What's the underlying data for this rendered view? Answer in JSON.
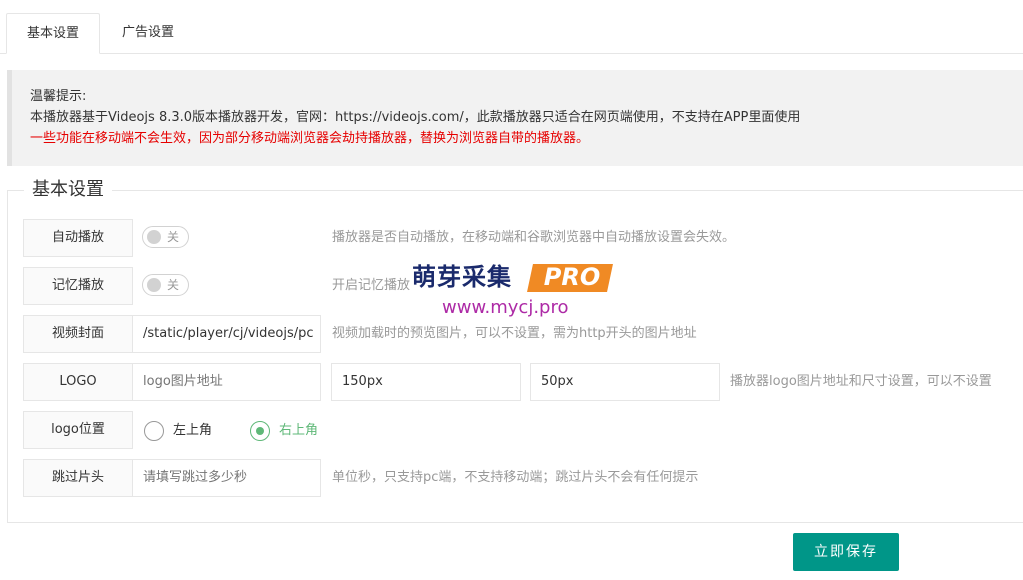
{
  "tabs": [
    {
      "label": "基本设置",
      "active": true
    },
    {
      "label": "广告设置",
      "active": false
    }
  ],
  "notice": {
    "title": "温馨提示:",
    "line1": "本播放器基于Videojs 8.3.0版本播放器开发，官网：https://videojs.com/，此款播放器只适合在网页端使用，不支持在APP里面使用",
    "line2_red": "一些功能在移动端不会生效，因为部分移动端浏览器会劫持播放器，替换为浏览器自带的播放器。"
  },
  "section": {
    "legend": "基本设置",
    "autoplay": {
      "label": "自动播放",
      "switch_text": "关",
      "switch_on": false,
      "help": "播放器是否自动播放，在移动端和谷歌浏览器中自动播放设置会失效。"
    },
    "memory": {
      "label": "记忆播放",
      "switch_text": "关",
      "switch_on": false,
      "help": "开启记忆播放"
    },
    "cover": {
      "label": "视频封面",
      "value": "/static/player/cj/videojs/pc",
      "help": "视频加载时的预览图片，可以不设置，需为http开头的图片地址"
    },
    "logo": {
      "label": "LOGO",
      "url_placeholder": "logo图片地址",
      "width_value": "150px",
      "height_value": "50px",
      "help": "播放器logo图片地址和尺寸设置，可以不设置"
    },
    "logo_position": {
      "label": "logo位置",
      "options": [
        {
          "label": "左上角",
          "checked": false
        },
        {
          "label": "右上角",
          "checked": true
        }
      ]
    },
    "skip_intro": {
      "label": "跳过片头",
      "placeholder": "请填写跳过多少秒",
      "help": "单位秒，只支持pc端，不支持移动端；跳过片头不会有任何提示"
    }
  },
  "watermark": {
    "brand_cn": "萌芽采集",
    "brand_badge": "PRO",
    "url": "www.mycj.pro",
    "badge_color": "#f08a24"
  },
  "save_button": {
    "label": "立即保存",
    "color": "#009688"
  }
}
